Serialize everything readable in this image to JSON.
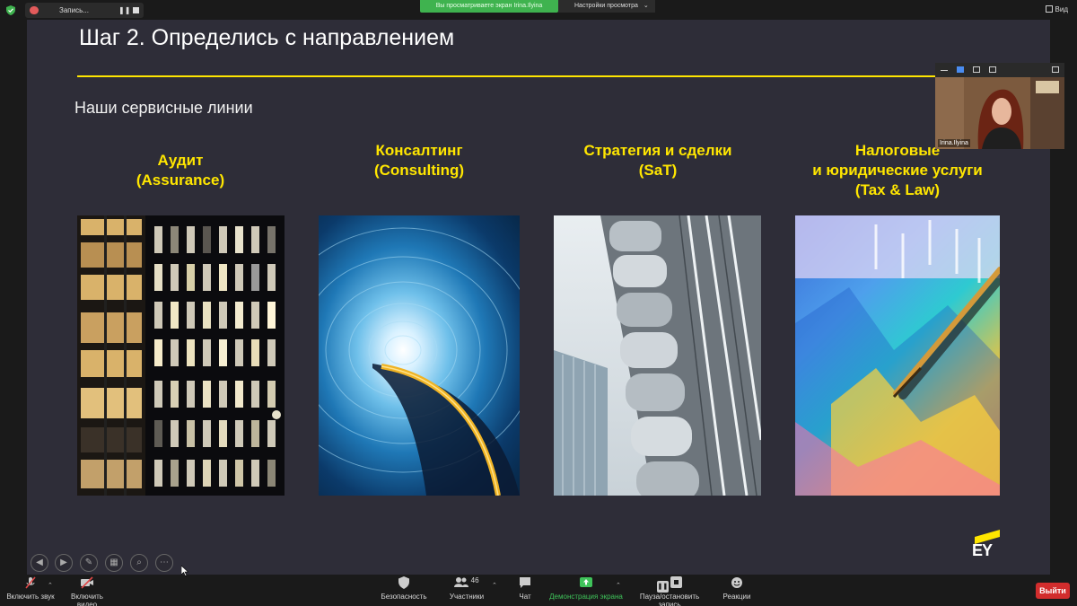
{
  "topbar": {
    "recording_label": "Запись...",
    "share_banner": "Вы просматриваете экран Irina.Ilyina",
    "view_options": "Настройки просмотра",
    "view_mode": "Вид"
  },
  "slide": {
    "title": "Шаг 2. Определись с направлением",
    "subtitle": "Наши сервисные линии",
    "services": [
      {
        "line1": "Аудит",
        "line2": "(Assurance)",
        "line3": ""
      },
      {
        "line1": "Консалтинг",
        "line2": "(Consulting)",
        "line3": ""
      },
      {
        "line1": "Стратегия и сделки",
        "line2": "(SaT)",
        "line3": ""
      },
      {
        "line1": "Налоговые",
        "line2": "и юридические услуги",
        "line3": "(Tax & Law)"
      }
    ],
    "logo_text": "EY",
    "accent_color": "#ffe600",
    "background_color": "#2e2d38"
  },
  "participant": {
    "name": "Irina.Ilyina"
  },
  "toolbar": {
    "mute_label": "Включить звук",
    "video_label": "Включить видео",
    "security_label": "Безопасность",
    "participants_label": "Участники",
    "participants_count": "46",
    "chat_label": "Чат",
    "share_label": "Демонстрация экрана",
    "record_label": "Пауза/остановить запись",
    "reactions_label": "Реакции",
    "leave_label": "Выйти"
  }
}
